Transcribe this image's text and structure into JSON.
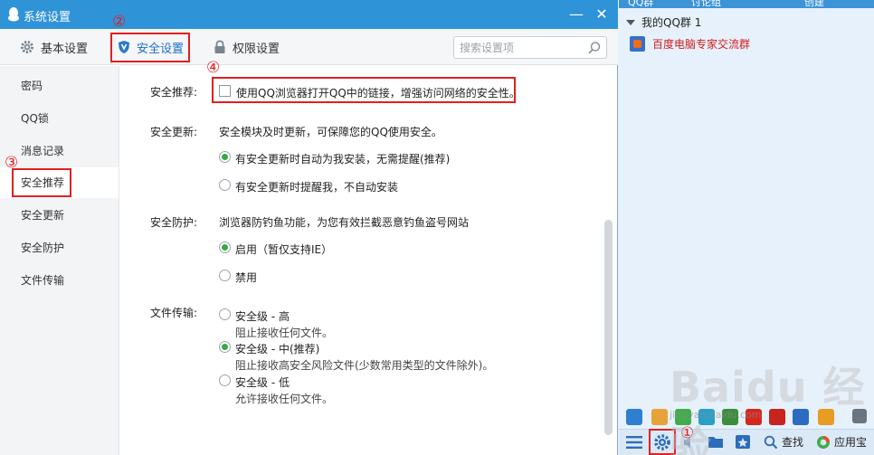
{
  "window": {
    "title": "系统设置"
  },
  "tabs": [
    {
      "label": "基本设置",
      "icon": "gear-icon"
    },
    {
      "label": "安全设置",
      "icon": "shield-icon",
      "active": true
    },
    {
      "label": "权限设置",
      "icon": "lock-icon"
    }
  ],
  "search": {
    "placeholder": "搜索设置项"
  },
  "sidebar": {
    "items": [
      {
        "label": "密码"
      },
      {
        "label": "QQ锁"
      },
      {
        "label": "消息记录"
      },
      {
        "label": "安全推荐",
        "active": true
      },
      {
        "label": "安全更新"
      },
      {
        "label": "安全防护"
      },
      {
        "label": "文件传输"
      }
    ]
  },
  "content": {
    "recommend": {
      "label": "安全推荐:",
      "checkbox": "使用QQ浏览器打开QQ中的链接，增强访问网络的安全性。",
      "checked": false
    },
    "update": {
      "label": "安全更新:",
      "desc": "安全模块及时更新，可保障您的QQ使用安全。",
      "options": [
        "有安全更新时自动为我安装，无需提醒(推荐)",
        "有安全更新时提醒我，不自动安装"
      ],
      "selected": 0
    },
    "protect": {
      "label": "安全防护:",
      "desc": "浏览器防钓鱼功能，为您有效拦截恶意钓鱼盗号网站",
      "options": [
        "启用（暂仅支持IE）",
        "禁用"
      ],
      "selected": 0
    },
    "transfer": {
      "label": "文件传输:",
      "options": [
        {
          "title": "安全级 - 高",
          "sub": "阻止接收任何文件。"
        },
        {
          "title": "安全级 - 中(推荐)",
          "sub": "阻止接收高安全风险文件(少数常用类型的文件除外)。"
        },
        {
          "title": "安全级 - 低",
          "sub": "允许接收任何文件。"
        }
      ],
      "selected": 1
    }
  },
  "annotations": {
    "n1": "①",
    "n2": "②",
    "n3": "③",
    "n4": "④",
    "color": "#e02020"
  },
  "panel": {
    "top_tabs": [
      "QQ群",
      "讨论组",
      "创建"
    ],
    "group_header": "我的QQ群 1",
    "group_item": "百度电脑专家交流群",
    "bottom": {
      "find": "查找",
      "appstore": "应用宝"
    },
    "watermark": "Baidu 经验",
    "watermark_sub": "jingyan.baidu.com"
  },
  "colors": {
    "titlebar": "#2f93d8",
    "accent": "#1e6fc4",
    "radio_on": "#3aa844"
  }
}
